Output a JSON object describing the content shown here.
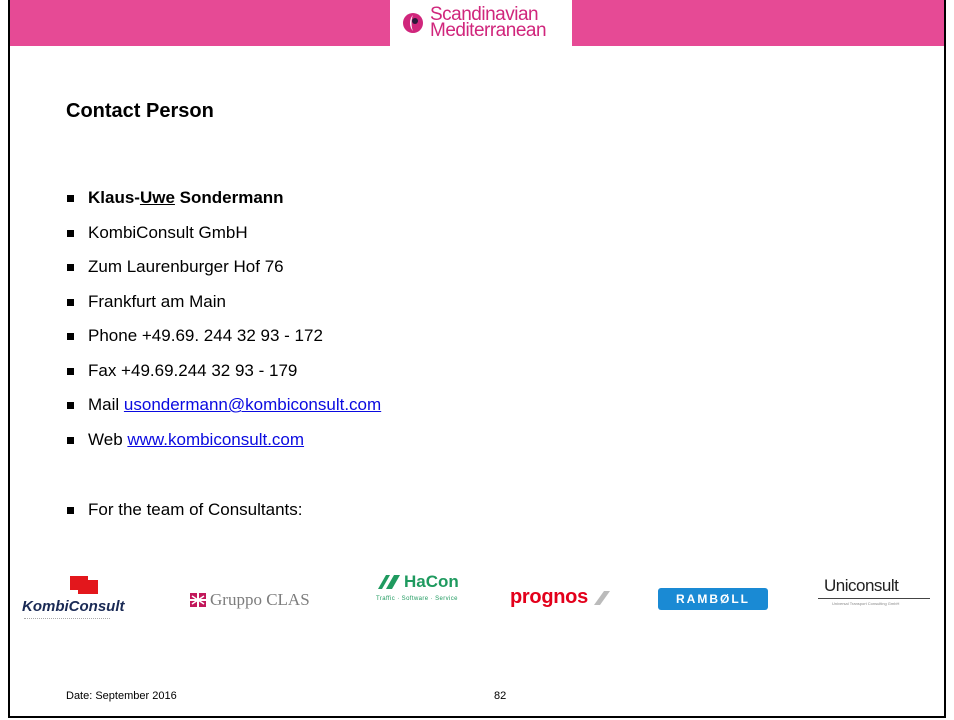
{
  "header": {
    "logo_line1": "Scandinavian",
    "logo_line2": "Mediterranean",
    "bar_color": "#e64a95"
  },
  "title": "Contact Person",
  "contact": {
    "name_part1": "Klaus-",
    "name_part2": "Uwe",
    "name_part3": " Sondermann",
    "company": "KombiConsult GmbH",
    "street": "Zum Laurenburger Hof 76",
    "city": "Frankfurt am Main",
    "phone": "Phone +49.69. 244 32 93 - 172",
    "fax": "Fax +49.69.244 32 93 - 179",
    "mail_label": "Mail ",
    "mail_value": "usondermann@kombiconsult.com",
    "web_label": "Web ",
    "web_value": "www.kombiconsult.com",
    "team_note": "For the team of Consultants:"
  },
  "logos": {
    "kombiconsult": "KombiConsult",
    "gruppo_clas": "Gruppo CLAS",
    "hacon": "HaCon",
    "hacon_tag": "Traffic · Software · Service",
    "prognos": "prognos",
    "ramboll": "RAMBØLL",
    "uniconsult": "Uniconsult",
    "uniconsult_tag": "Universal Transport Consulting GmbH"
  },
  "footer": {
    "date": "Date: September 2016",
    "page": "82"
  }
}
